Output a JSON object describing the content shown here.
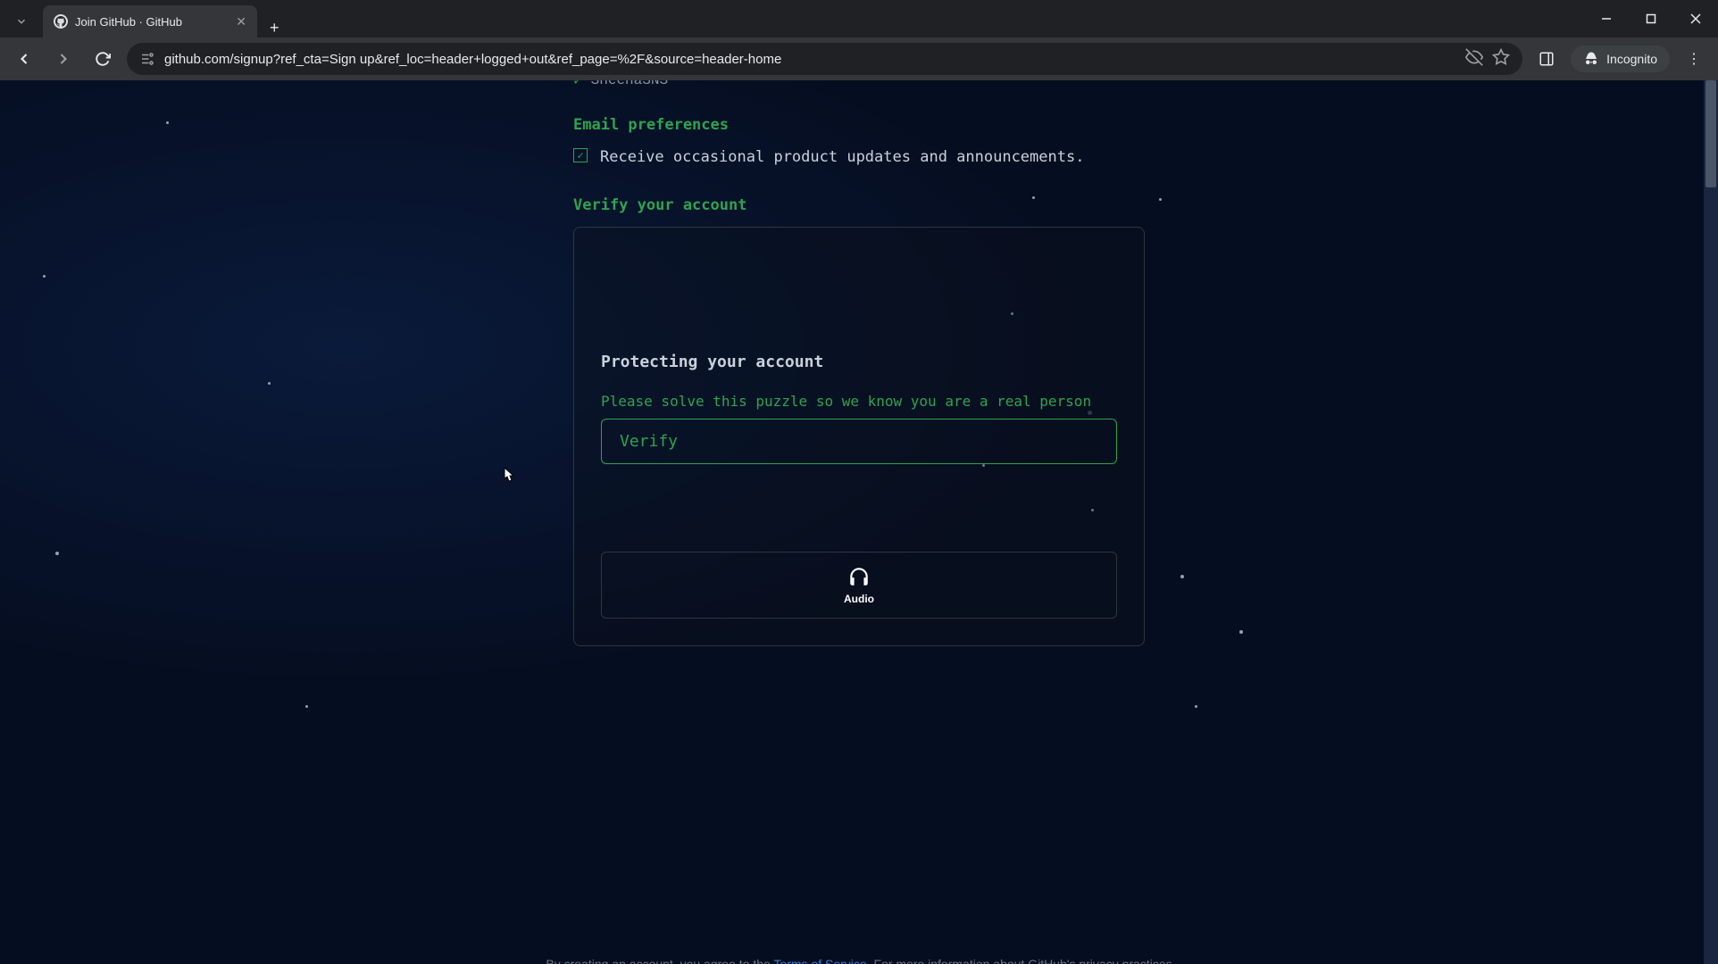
{
  "browser": {
    "tab_title": "Join GitHub · GitHub",
    "url": "github.com/signup?ref_cta=Sign up&ref_loc=header+logged+out&ref_page=%2F&source=header-home",
    "incognito_label": "Incognito"
  },
  "form": {
    "username": "SheenaSNS",
    "email_prefs_label": "Email preferences",
    "checkbox_label": "Receive occasional product updates and announcements.",
    "checkbox_checked": true,
    "verify_section_label": "Verify your account",
    "protect_heading": "Protecting your account",
    "puzzle_text": "Please solve this puzzle so we know you are a real person",
    "verify_button": "Verify",
    "audio_button": "Audio"
  },
  "footer": {
    "prefix": "By creating an account, you agree to the ",
    "tos": "Terms of Service",
    "suffix": ". For more information about GitHub's privacy practices"
  },
  "colors": {
    "accent": "#2da44e",
    "text": "#c9d1d9",
    "bg_dark": "#050d20"
  }
}
